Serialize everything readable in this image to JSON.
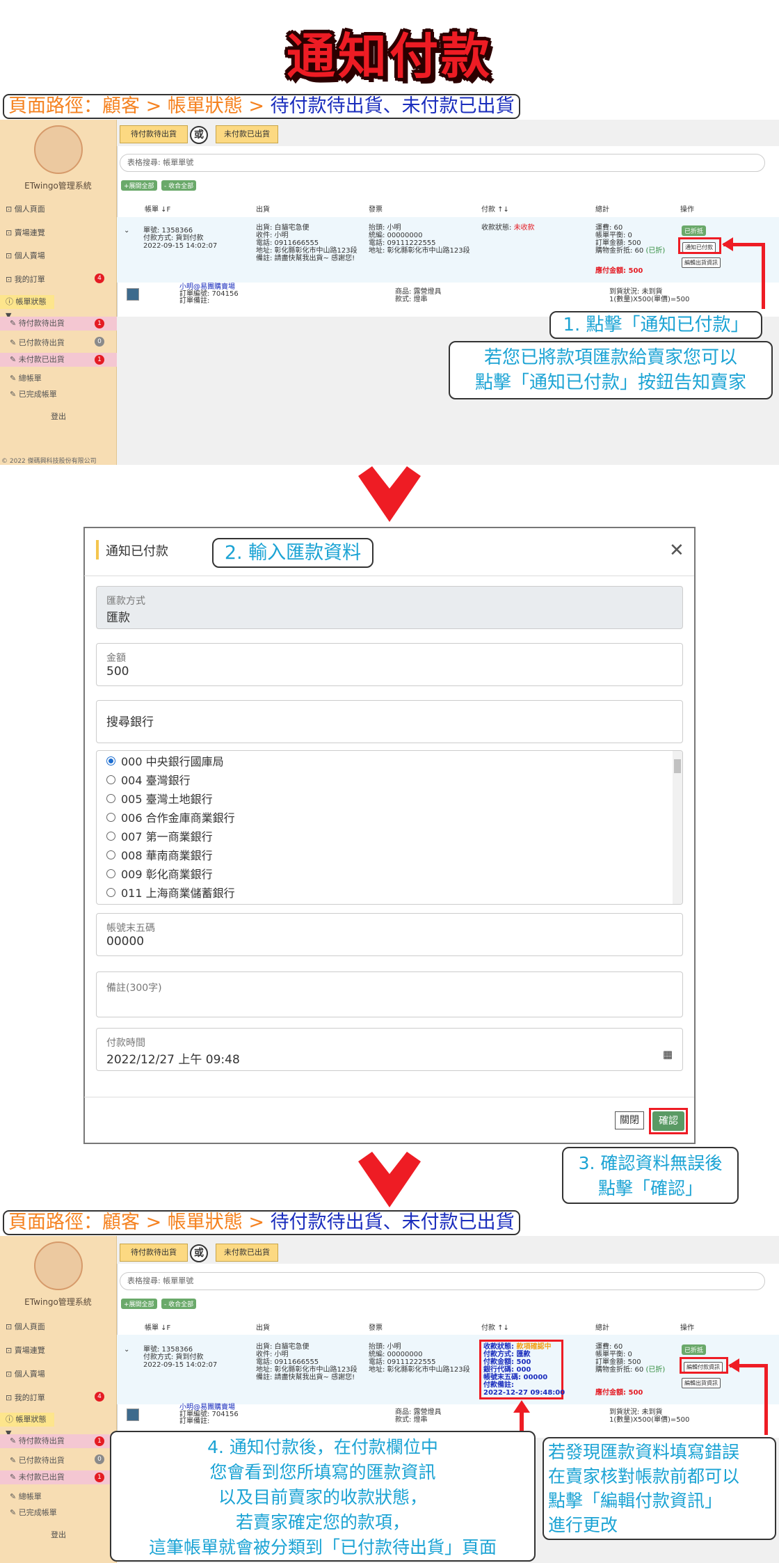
{
  "page_title": "通知付款",
  "path": {
    "prefix": "頁面路徑：",
    "customer": "顧客",
    "sep1": " > ",
    "billing": "帳單狀態",
    "sep2": " > ",
    "target": "待付款待出貨、未付款已出貨"
  },
  "sidebar": {
    "system_name": "ETwingo管理系統",
    "items": [
      {
        "label": "個人頁面"
      },
      {
        "label": "賣場連覽"
      },
      {
        "label": "個人賣場"
      },
      {
        "label": "我的訂單",
        "badge": "4"
      },
      {
        "label": "帳單狀態 ▼"
      },
      {
        "label": "待付款待出貨",
        "badge": "1"
      },
      {
        "label": "已付款待出貨",
        "badge": "0"
      },
      {
        "label": "未付款已出貨",
        "badge": "1"
      },
      {
        "label": "總帳單"
      },
      {
        "label": "已完成帳單"
      },
      {
        "label": "登出"
      }
    ],
    "footer": "© 2022 傑碼興科技股份有限公司"
  },
  "tabs": {
    "pending": "待付款待出貨",
    "or": "或",
    "unpaid_shipped": "未付款已出貨"
  },
  "table": {
    "search_placeholder": "表格搜尋: 帳單單號",
    "expand_all": "+展開全部",
    "collapse_all": "- 收合全部",
    "headers": [
      "帳單 ↓F",
      "出貨",
      "發票",
      "付款 ↑↓",
      "總計",
      "操作"
    ],
    "row": {
      "order": [
        "單號: 1358366",
        "付款方式: 貨到付款",
        "2022-09-15 14:02:07"
      ],
      "shipping": [
        "出貨: 白貓宅急便",
        "收件: 小明",
        "電話: 0911666555",
        "地址: 彰化縣彰化市中山路123段",
        "備註: 請盡快幫我出貨~ 感謝您!"
      ],
      "invoice": [
        "抬頭: 小明",
        "統編: 00000000",
        "電話: 09111222555",
        "地址: 彰化縣彰化市中山路123段"
      ],
      "payment_before": {
        "label": "收款狀態: ",
        "status": "未收款"
      },
      "payment_after": {
        "status_label": "收款狀態: ",
        "status": "款項確認中",
        "lines": [
          "付款方式: 匯款",
          "付款金額: 500",
          "銀行代碼: 000",
          "帳號末五碼: 00000",
          "付款備註:"
        ],
        "time": "2022-12-27 09:48:00"
      },
      "total": [
        "運費: 60",
        "帳單平衡: 0",
        "訂單金額: 500"
      ],
      "discount_label": "購物金折抵: 60",
      "discount_tag": "(已折)",
      "amount_due": "應付金額: 500",
      "ops_tag": "已折抵",
      "notify_button": "通知已付款",
      "edit_payment_button": "編輯付款資訊",
      "edit_shipping_button": "編輯出貨資訊"
    },
    "sub_row": {
      "store": "小明@易團購賣場",
      "id": "訂單編號: 704156",
      "remark": "訂單備註:",
      "product": "商品: 露營燈具",
      "spec": "款式: 燈串",
      "arrival": "到貨狀況: 未到貨",
      "qty": "1(數量)X500(單價)=500"
    }
  },
  "notes": {
    "step1": "1. 點擊「通知已付款」",
    "step1_desc1": "若您已將款項匯款給賣家您可以",
    "step1_desc2": "點擊「通知已付款」按鈕告知賣家",
    "step2": "2. 輸入匯款資料",
    "step3_1": "3. 確認資料無誤後",
    "step3_2": "點擊「確認」",
    "step4": [
      "4. 通知付款後，在付款欄位中",
      "您會看到您所填寫的匯款資訊",
      "以及目前賣家的收款狀態，",
      "若賣家確定您的款項，",
      "這筆帳單就會被分類到「已付款待出貨」頁面"
    ],
    "edit_note": [
      "若發現匯款資料填寫錯誤",
      "在賣家核對帳款前都可以",
      "點擊「編輯付款資訊」",
      "進行更改"
    ]
  },
  "modal": {
    "title": "通知已付款",
    "method_label": "匯款方式",
    "method_value": "匯款",
    "amount_label": "金額",
    "amount_value": "500",
    "bank_search": "搜尋銀行",
    "banks": [
      "000 中央銀行國庫局",
      "004 臺灣銀行",
      "005 臺灣土地銀行",
      "006 合作金庫商業銀行",
      "007 第一商業銀行",
      "008 華南商業銀行",
      "009 彰化商業銀行",
      "011 上海商業儲蓄銀行"
    ],
    "account_label": "帳號末五碼",
    "account_value": "00000",
    "note_label": "備註(300字)",
    "time_label": "付款時間",
    "time_value": "2022/12/27 上午 09:48",
    "close_button": "關閉",
    "confirm_button": "確認"
  },
  "colors": {
    "accent_red": "#ee1c24",
    "note_blue": "#1ba3d4",
    "path_orange": "#f58220",
    "path_blue": "#1a2dbd",
    "sidebar_bg": "#f7ddb3",
    "confirm_green": "#5a9a64"
  }
}
